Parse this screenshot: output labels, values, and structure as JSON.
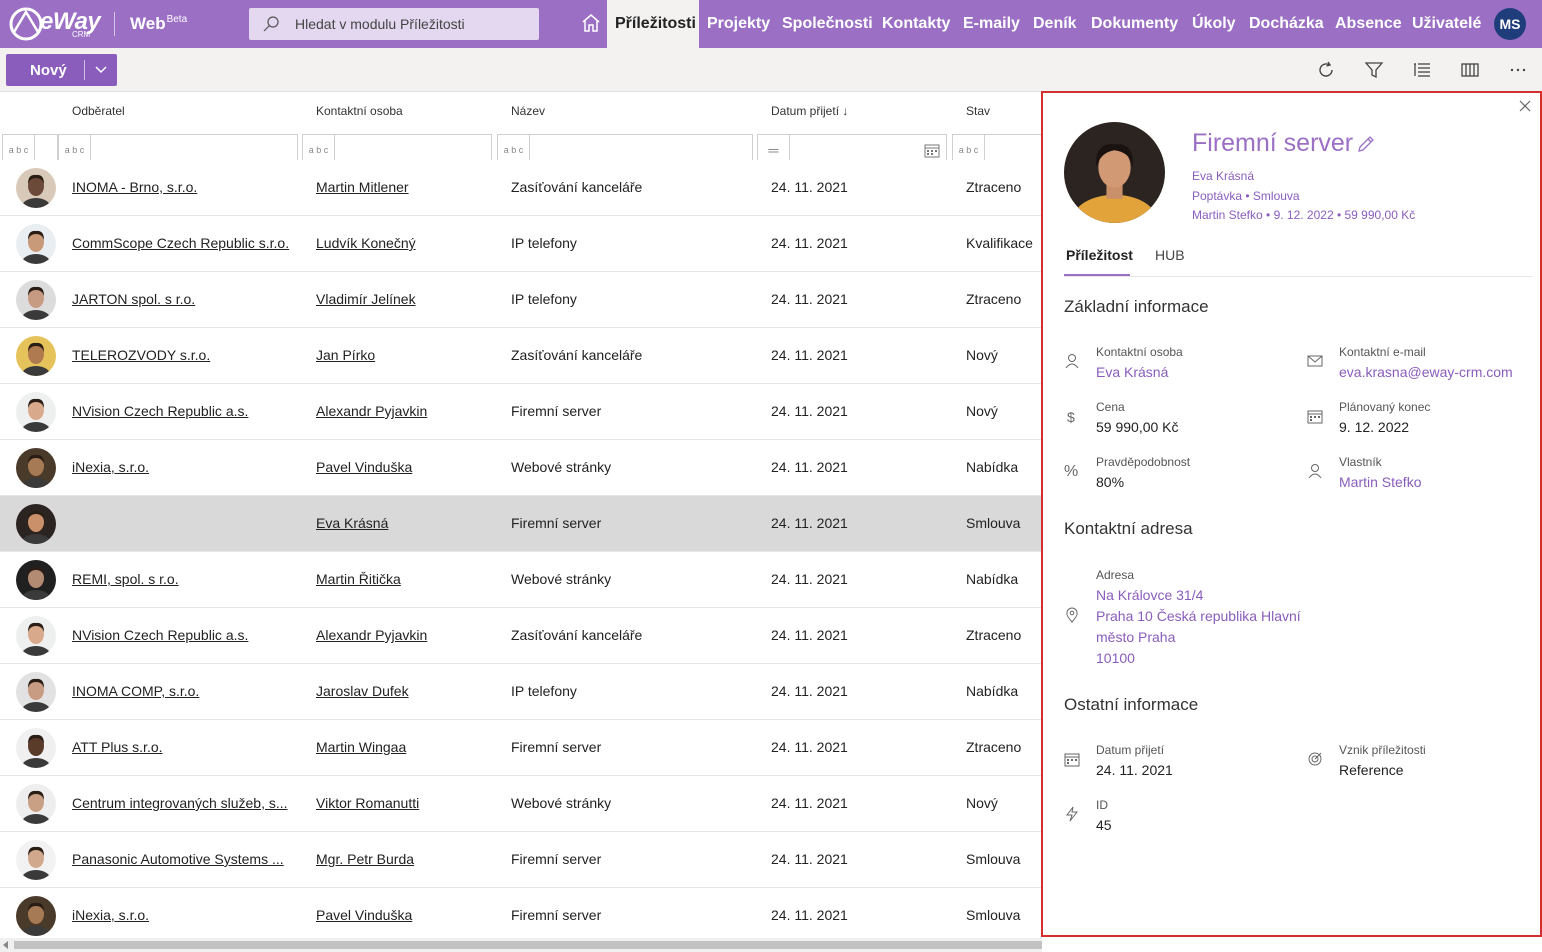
{
  "app": {
    "logo_text": "eWay",
    "logo_sub": "CRM",
    "brand": "Web",
    "brand_sup": "Beta",
    "search_placeholder": "Hledat v modulu Příležitosti",
    "user_initials": "MS"
  },
  "nav": [
    {
      "label": "Příležitosti",
      "active": true
    },
    {
      "label": "Projekty"
    },
    {
      "label": "Společnosti"
    },
    {
      "label": "Kontakty"
    },
    {
      "label": "E-maily"
    },
    {
      "label": "Deník"
    },
    {
      "label": "Dokumenty"
    },
    {
      "label": "Úkoly"
    },
    {
      "label": "Docházka"
    },
    {
      "label": "Absence"
    },
    {
      "label": "Uživatelé"
    }
  ],
  "toolbar": {
    "new_label": "Nový"
  },
  "table": {
    "headers": [
      "Odběratel",
      "Kontaktní osoba",
      "Název",
      "Datum přijetí ↓",
      "Stav"
    ],
    "filter_glyph": "a b c",
    "rows": [
      {
        "customer": "INOMA - Brno, s.r.o.",
        "contact": "Martin Mitlener",
        "name": "Zasíťování kanceláře",
        "date": "24. 11. 2021",
        "state": "Ztraceno",
        "skin": "#6b4a3a",
        "bg": "#d8c9b8"
      },
      {
        "customer": "CommScope Czech Republic s.r.o.",
        "contact": "Ludvík Konečný",
        "name": "IP telefony",
        "date": "24. 11. 2021",
        "state": "Kvalifikace",
        "skin": "#c99a7a",
        "bg": "#e9eef2"
      },
      {
        "customer": "JARTON spol. s r.o.",
        "contact": "Vladimír Jelínek",
        "name": "IP telefony",
        "date": "24. 11. 2021",
        "state": "Ztraceno",
        "skin": "#c79b82",
        "bg": "#dcdcdc"
      },
      {
        "customer": "TELEROZVODY s.r.o.",
        "contact": "Jan Pírko",
        "name": "Zasíťování kanceláře",
        "date": "24. 11. 2021",
        "state": "Nový",
        "skin": "#b07a50",
        "bg": "#e6c35a"
      },
      {
        "customer": "NVision Czech Republic a.s.",
        "contact": "Alexandr Pyjavkin",
        "name": "Firemní server",
        "date": "24. 11. 2021",
        "state": "Nový",
        "skin": "#d8a98a",
        "bg": "#eef0f0"
      },
      {
        "customer": "iNexia, s.r.o.",
        "contact": "Pavel Vinduška",
        "name": "Webové stránky",
        "date": "24. 11. 2021",
        "state": "Nabídka",
        "skin": "#a57a55",
        "bg": "#4a3a2a"
      },
      {
        "customer": "",
        "contact": "Eva Krásná",
        "name": "Firemní server",
        "date": "24. 11. 2021",
        "state": "Smlouva",
        "skin": "#c9906a",
        "bg": "#2c2420",
        "selected": true
      },
      {
        "customer": "REMI, spol. s r.o.",
        "contact": "Martin Řitička",
        "name": "Webové stránky",
        "date": "24. 11. 2021",
        "state": "Nabídka",
        "skin": "#b38b72",
        "bg": "#202020"
      },
      {
        "customer": "NVision Czech Republic a.s.",
        "contact": "Alexandr Pyjavkin",
        "name": "Zasíťování kanceláře",
        "date": "24. 11. 2021",
        "state": "Ztraceno",
        "skin": "#d8a98a",
        "bg": "#eef0f0"
      },
      {
        "customer": "INOMA COMP, s.r.o.",
        "contact": "Jaroslav Dufek",
        "name": "IP telefony",
        "date": "24. 11. 2021",
        "state": "Nabídka",
        "skin": "#c89c82",
        "bg": "#e2e2e2"
      },
      {
        "customer": "ATT Plus s.r.o.",
        "contact": "Martin Wingaa",
        "name": "Firemní server",
        "date": "24. 11. 2021",
        "state": "Ztraceno",
        "skin": "#5a3a28",
        "bg": "#f0f0f0"
      },
      {
        "customer": "Centrum integrovaných služeb, s...",
        "contact": "Viktor Romanutti",
        "name": "Webové stránky",
        "date": "24. 11. 2021",
        "state": "Nový",
        "skin": "#caa084",
        "bg": "#eeeeee"
      },
      {
        "customer": "Panasonic Automotive Systems ...",
        "contact": "Mgr. Petr Burda",
        "name": "Firemní server",
        "date": "24. 11. 2021",
        "state": "Smlouva",
        "skin": "#d2a88c",
        "bg": "#f2f2f2"
      },
      {
        "customer": "iNexia, s.r.o.",
        "contact": "Pavel Vinduška",
        "name": "Firemní server",
        "date": "24. 11. 2021",
        "state": "Smlouva",
        "skin": "#a57a55",
        "bg": "#4a3a2a"
      }
    ]
  },
  "detail": {
    "title": "Firemní server",
    "meta1": "Eva Krásná",
    "meta2": "Poptávka  •  Smlouva",
    "meta3": "Martin Stefko  •  9. 12. 2022  •  59 990,00 Kč",
    "tabs": [
      "Příležitost",
      "HUB"
    ],
    "section_basic": "Základní informace",
    "section_address": "Kontaktní adresa",
    "section_other": "Ostatní informace",
    "fields": {
      "contact_label": "Kontaktní osoba",
      "contact_value": "Eva Krásná",
      "email_label": "Kontaktní e-mail",
      "email_value": "eva.krasna@eway-crm.com",
      "price_label": "Cena",
      "price_value": "59 990,00 Kč",
      "end_label": "Plánovaný konec",
      "end_value": "9. 12. 2022",
      "prob_label": "Pravděpodobnost",
      "prob_value": "80%",
      "owner_label": "Vlastník",
      "owner_value": "Martin Stefko",
      "address_label": "Adresa",
      "address_l1": "Na Královce 31/4",
      "address_l2": "Praha 10 Česká republika Hlavní",
      "address_l3": "město Praha",
      "address_l4": "10100",
      "received_label": "Datum přijetí",
      "received_value": "24. 11. 2021",
      "origin_label": "Vznik příležitosti",
      "origin_value": "Reference",
      "id_label": "ID",
      "id_value": "45"
    },
    "colors": {
      "accent": "#9b6fc4",
      "border": "#d32f2f"
    }
  }
}
